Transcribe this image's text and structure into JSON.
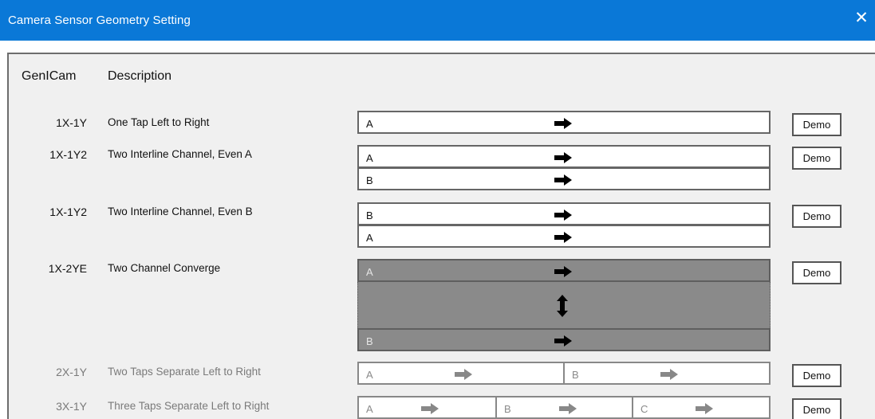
{
  "window": {
    "title": "Camera Sensor Geometry Setting"
  },
  "headers": {
    "genicam": "GenICam",
    "description": "Description"
  },
  "rows": [
    {
      "code": "1X-1Y",
      "description": "One Tap Left to Right",
      "taps": [
        "A"
      ],
      "demo": "Demo"
    },
    {
      "code": "1X-1Y2",
      "description": "Two Interline Channel, Even A",
      "taps": [
        "A",
        "B"
      ],
      "demo": "Demo"
    },
    {
      "code": "1X-1Y2",
      "description": "Two Interline Channel, Even B",
      "taps": [
        "B",
        "A"
      ],
      "demo": "Demo"
    },
    {
      "code": "1X-2YE",
      "description": "Two Channel Converge",
      "taps": [
        "A",
        "B"
      ],
      "demo": "Demo"
    },
    {
      "code": "2X-1Y",
      "description": "Two Taps Separate Left to Right",
      "taps": [
        "A",
        "B"
      ],
      "demo": "Demo"
    },
    {
      "code": "3X-1Y",
      "description": "Three Taps Separate Left to Right",
      "taps": [
        "A",
        "B",
        "C"
      ],
      "demo": "Demo"
    }
  ],
  "icons": {
    "close": "close-icon",
    "arrow": "arrow-right-icon",
    "vertical": "arrow-up-down-icon"
  },
  "colors": {
    "titlebar": "#0a78d7",
    "panel": "#f0f0f0",
    "selected_row": "#8a8a8a"
  }
}
